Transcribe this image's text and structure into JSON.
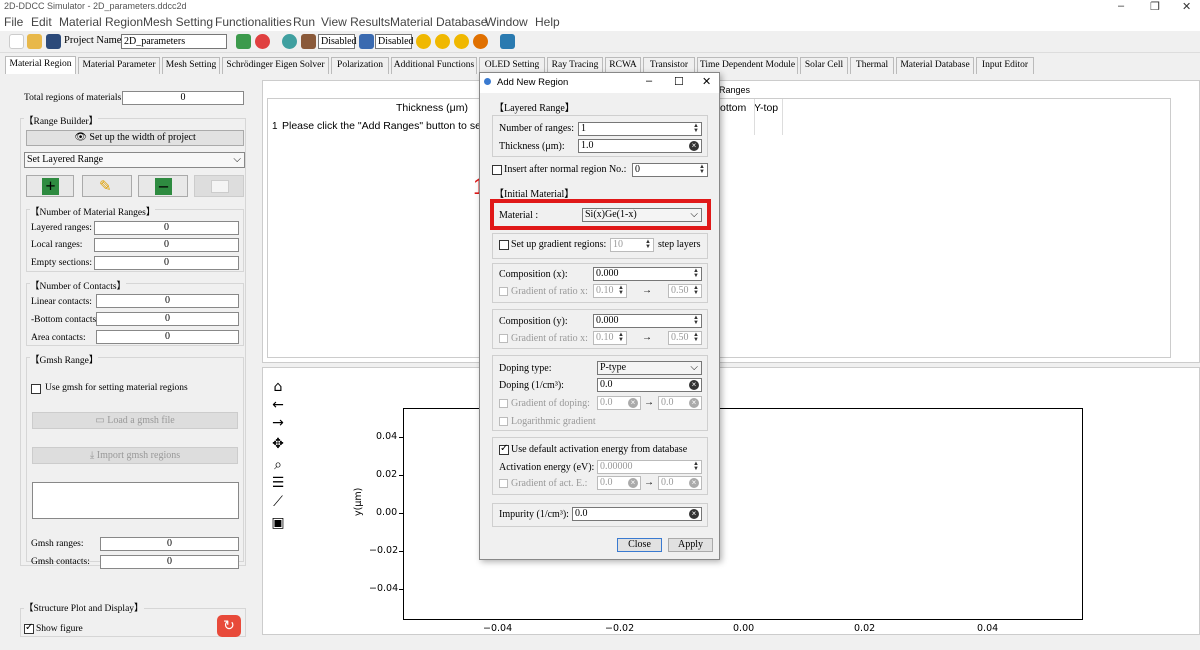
{
  "window": {
    "title": "2D-DDCC Simulator - 2D_parameters.ddcc2d",
    "minimize": "–",
    "restore": "❐",
    "close": "✕"
  },
  "menu": [
    "File",
    "Edit",
    "Material Region",
    "Mesh Setting",
    "Functionalities",
    "Run",
    "View Results",
    "Material Database",
    "Window",
    "Help"
  ],
  "toolbar": {
    "project_label": "Project Name:",
    "project_name": "2D_parameters",
    "status1": "Disabled",
    "status2": "Disabled"
  },
  "tabs": [
    "Material Region",
    "Material Parameter",
    "Mesh Setting",
    "Schrödinger Eigen Solver",
    "Polarization",
    "Additional Functions",
    "OLED Setting",
    "Ray Tracing",
    "RCWA",
    "Transistor",
    "Time Dependent Module",
    "Solar Cell",
    "Thermal",
    "Material Database",
    "Input Editor"
  ],
  "left": {
    "total_label": "Total regions of materials:",
    "total_value": "0",
    "range_builder": "【Range Builder】",
    "setup_width": "Set up the width of project",
    "set_layered": "Set Layered Range",
    "num_ranges_title": "【Number of Material Ranges】",
    "layered_label": "Layered ranges:",
    "layered_value": "0",
    "local_label": "Local ranges:",
    "local_value": "0",
    "empty_label": "Empty sections:",
    "empty_value": "0",
    "contacts_title": "【Number of Contacts】",
    "linear_label": "Linear contacts:",
    "linear_value": "0",
    "bottom_label": "-Bottom contacts:",
    "bottom_value": "0",
    "area_label": "Area contacts:",
    "area_value": "0",
    "gmsh_title": "【Gmsh Range】",
    "use_gmsh": "Use gmsh for setting material regions",
    "load_gmsh": "Load a gmsh file",
    "import_gmsh": "Import gmsh regions",
    "gmsh_ranges_label": "Gmsh ranges:",
    "gmsh_ranges_value": "0",
    "gmsh_contacts_label": "Gmsh contacts:",
    "gmsh_contacts_value": "0",
    "structure_title": "【Structure Plot and Display】",
    "show_figure": "Show figure"
  },
  "table": {
    "section": "Ranges",
    "col_thickness": "Thickness (μm)",
    "col_bottom": "ottom",
    "col_ytop": "Y-top",
    "row_num": "1",
    "row_text": "Please click the \"Add Ranges\" button to set up"
  },
  "plot": {
    "ylabel": "y(μm)",
    "yticks": [
      "0.04",
      "0.02",
      "0.00",
      "−0.02",
      "−0.04"
    ],
    "xticks": [
      "−0.04",
      "−0.02",
      "0.00",
      "0.02",
      "0.04"
    ]
  },
  "dialog": {
    "title": "Add New Region",
    "layered_title": "【Layered Range】",
    "num_ranges_label": "Number of ranges:",
    "num_ranges_value": "1",
    "thickness_label": "Thickness (μm):",
    "thickness_value": "1.0",
    "insert_after_label": "Insert after normal region No.:",
    "insert_after_value": "0",
    "initial_title": "【Initial Material】",
    "material_label": "Material :",
    "material_value": "Si(x)Ge(1-x)",
    "gradient_label": "Set up gradient regions:",
    "gradient_value": "10",
    "step_layers": "step layers",
    "comp_x_label": "Composition (x):",
    "comp_x_value": "0.000",
    "grad_ratio_x": "Gradient of ratio x:",
    "grad_x_from": "0.10",
    "grad_x_to": "0.50",
    "comp_y_label": "Composition (y):",
    "comp_y_value": "0.000",
    "grad_ratio_y": "Gradient of ratio x:",
    "grad_y_from": "0.10",
    "grad_y_to": "0.50",
    "doping_type_label": "Doping type:",
    "doping_type_value": "P-type",
    "doping_label": "Doping (1/cm³):",
    "doping_value": "0.0",
    "grad_doping": "Gradient of doping:",
    "grad_doping_from": "0.0",
    "grad_doping_to": "0.0",
    "log_gradient": "Logarithmic gradient",
    "use_default_act": "Use default activation energy from database",
    "act_energy_label": "Activation energy (eV):",
    "act_energy_value": "0.00000",
    "grad_act": "Gradient of act. E.:",
    "grad_act_from": "0.0",
    "grad_act_to": "0.0",
    "impurity_label": "Impurity (1/cm³):",
    "impurity_value": "0.0",
    "close": "Close",
    "apply": "Apply",
    "arrow": "→"
  },
  "annotation": {
    "number": "1",
    "color": "#e01818"
  }
}
